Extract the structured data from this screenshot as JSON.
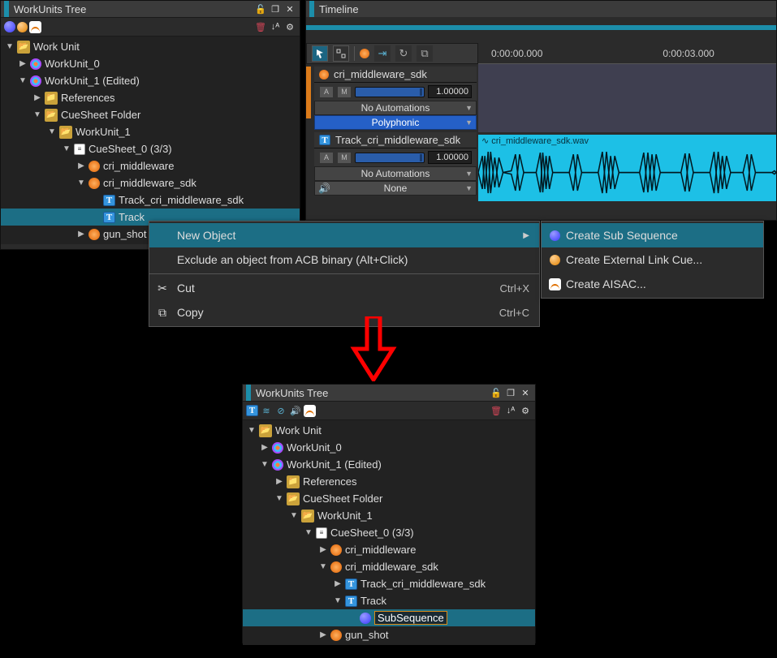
{
  "panels": {
    "tree_title": "WorkUnits Tree",
    "timeline_title": "Timeline"
  },
  "tree1": {
    "root": "Work Unit",
    "wu0": "WorkUnit_0",
    "wu1": "WorkUnit_1 (Edited)",
    "refs": "References",
    "csfolder": "CueSheet Folder",
    "wu1b": "WorkUnit_1",
    "cs0": "CueSheet_0 (3/3)",
    "cue1": "cri_middleware",
    "cue2": "cri_middleware_sdk",
    "track1": "Track_cri_middleware_sdk",
    "track2": "Track",
    "cue3": "gun_shot"
  },
  "tracks": {
    "cue_name": "cri_middleware_sdk",
    "track_name": "Track_cri_middleware_sdk",
    "value": "1.00000",
    "auto": "No Automations",
    "poly": "Polyphonic",
    "none": "None",
    "clip": "cri_middleware_sdk.wav"
  },
  "timeline": {
    "t0": "0:00:00.000",
    "t3": "0:00:03.000"
  },
  "menu1": {
    "new_object": "New Object",
    "exclude": "Exclude an object from ACB binary (Alt+Click)",
    "cut": "Cut",
    "cut_sc": "Ctrl+X",
    "copy": "Copy",
    "copy_sc": "Ctrl+C"
  },
  "menu2": {
    "subseq": "Create Sub Sequence",
    "extlink": "Create External Link Cue...",
    "aisac": "Create AISAC..."
  },
  "tree2": {
    "subseq": "SubSequence"
  }
}
